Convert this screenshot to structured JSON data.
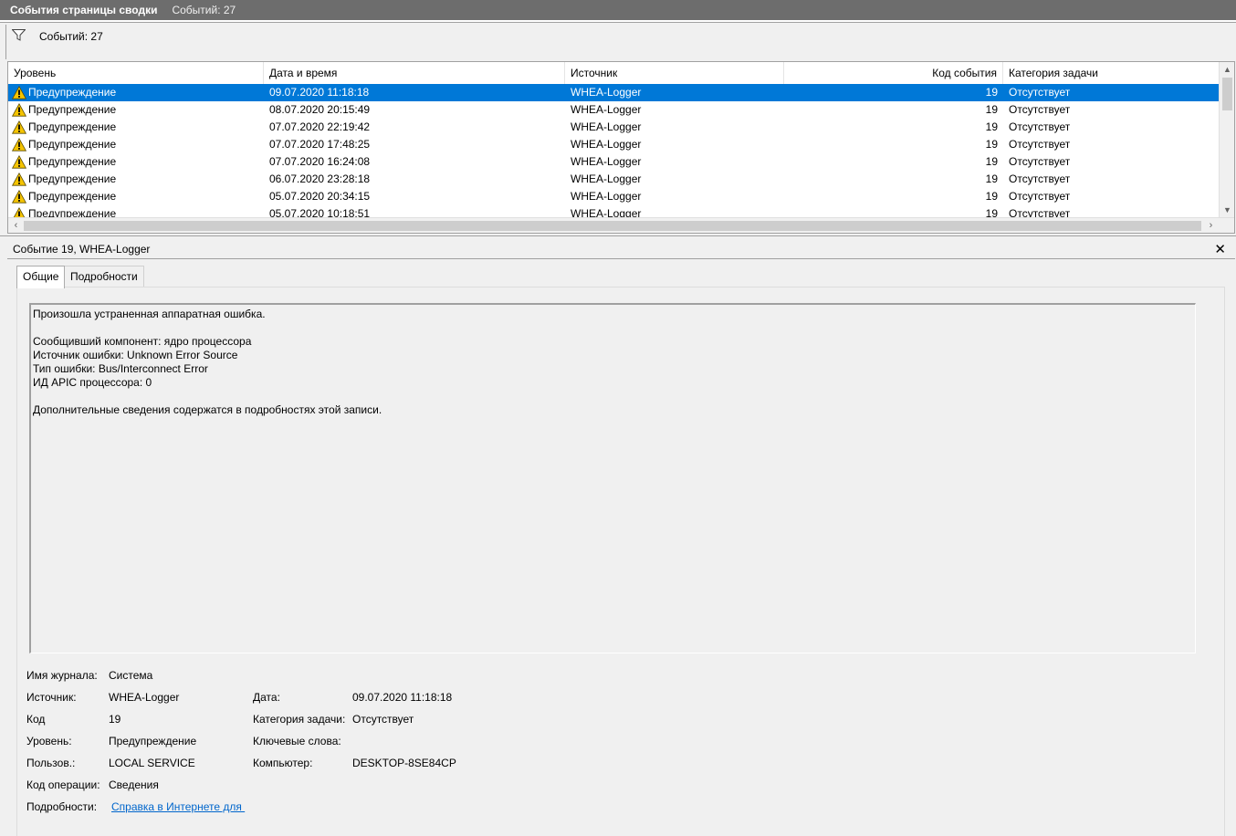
{
  "titlebar": {
    "title": "События страницы сводки",
    "count": "Событий: 27"
  },
  "filterbar": {
    "icon": "filter-icon",
    "text": "Событий: 27"
  },
  "grid": {
    "columns": [
      "Уровень",
      "Дата и время",
      "Источник",
      "Код события",
      "Категория задачи"
    ],
    "rows": [
      {
        "level": "Предупреждение",
        "date": "09.07.2020 11:18:18",
        "source": "WHEA-Logger",
        "code": "19",
        "category": "Отсутствует"
      },
      {
        "level": "Предупреждение",
        "date": "08.07.2020 20:15:49",
        "source": "WHEA-Logger",
        "code": "19",
        "category": "Отсутствует"
      },
      {
        "level": "Предупреждение",
        "date": "07.07.2020 22:19:42",
        "source": "WHEA-Logger",
        "code": "19",
        "category": "Отсутствует"
      },
      {
        "level": "Предупреждение",
        "date": "07.07.2020 17:48:25",
        "source": "WHEA-Logger",
        "code": "19",
        "category": "Отсутствует"
      },
      {
        "level": "Предупреждение",
        "date": "07.07.2020 16:24:08",
        "source": "WHEA-Logger",
        "code": "19",
        "category": "Отсутствует"
      },
      {
        "level": "Предупреждение",
        "date": "06.07.2020 23:28:18",
        "source": "WHEA-Logger",
        "code": "19",
        "category": "Отсутствует"
      },
      {
        "level": "Предупреждение",
        "date": "05.07.2020 20:34:15",
        "source": "WHEA-Logger",
        "code": "19",
        "category": "Отсутствует"
      },
      {
        "level": "Предупреждение",
        "date": "05.07.2020 10:18:51",
        "source": "WHEA-Logger",
        "code": "19",
        "category": "Отсутствует"
      }
    ],
    "level_icon": "warning-icon",
    "colors": {
      "selection": "#0078d7",
      "warning": "#f5c400"
    }
  },
  "detail": {
    "title": "Событие 19, WHEA-Logger",
    "close": "✕",
    "tabs": [
      "Общие",
      "Подробности"
    ],
    "description": [
      "Произошла устраненная аппаратная ошибка.",
      "",
      "Сообщивший компонент: ядро процессора",
      "Источник ошибки: Unknown Error Source",
      "Тип ошибки: Bus/Interconnect Error",
      "ИД APIC процессора: 0",
      "",
      "Дополнительные сведения содержатся в подробностях этой записи."
    ],
    "props": {
      "log_label": "Имя журнала:",
      "log_value": "Система",
      "source_label": "Источник:",
      "source_value": "WHEA-Logger",
      "date_label": "Дата:",
      "date_value": "09.07.2020 11:18:18",
      "code_label": "Код",
      "code_value": "19",
      "category_label": "Категория задачи:",
      "category_value": "Отсутствует",
      "level_label": "Уровень:",
      "level_value": "Предупреждение",
      "keywords_label": "Ключевые слова:",
      "keywords_value": "",
      "user_label": "Пользов.:",
      "user_value": "LOCAL SERVICE",
      "computer_label": "Компьютер:",
      "computer_value": "DESKTOP-8SE84CP",
      "opcode_label": "Код операции:",
      "opcode_value": "Сведения",
      "details_label": "Подробности:",
      "details_link": "Справка в Интернете для "
    }
  }
}
